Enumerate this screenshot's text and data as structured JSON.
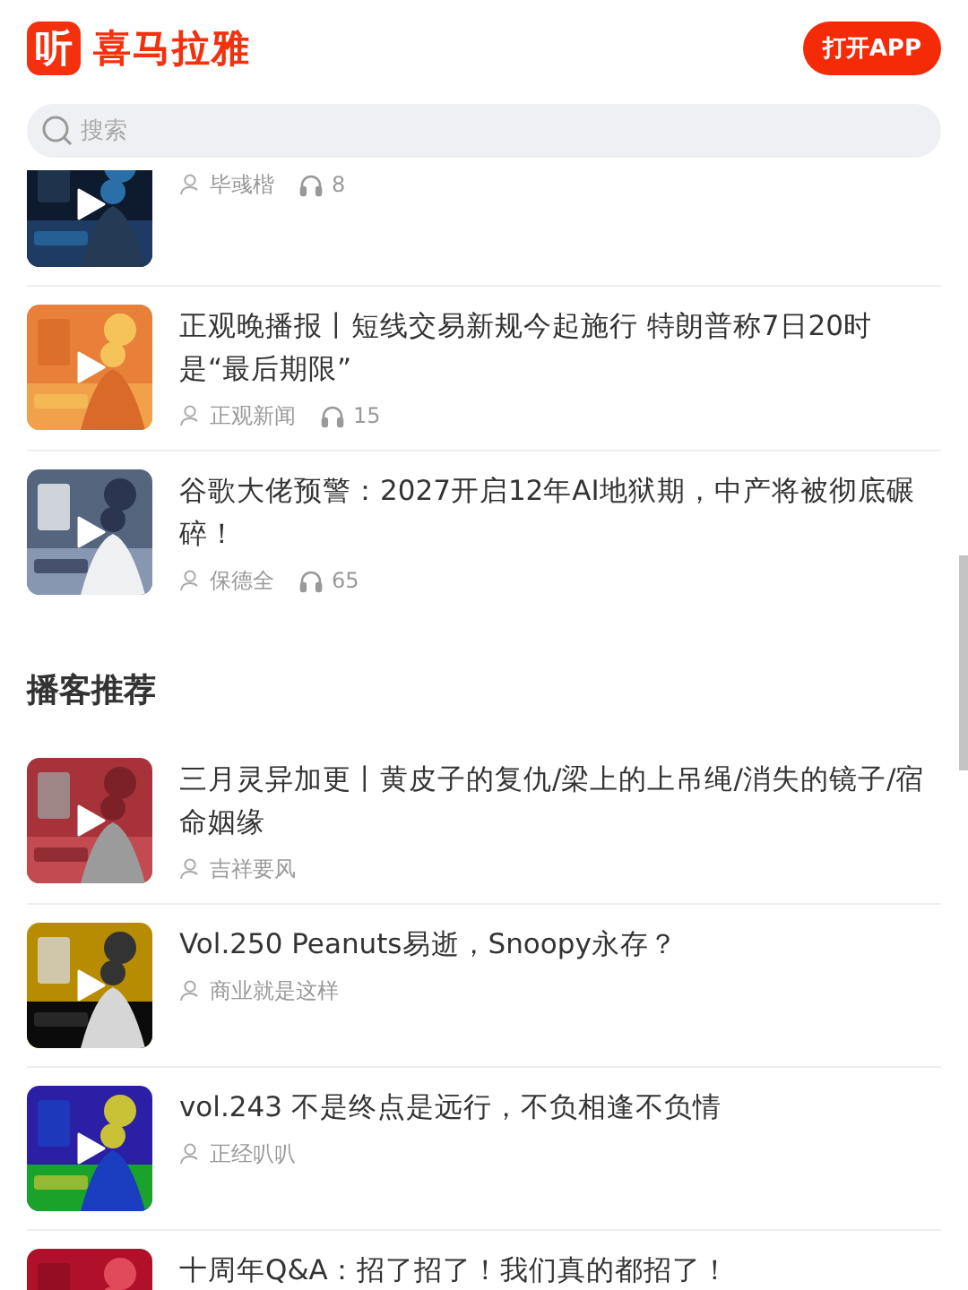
{
  "header": {
    "logo": {
      "mark": "听",
      "name": "喜马拉雅"
    },
    "open_app_button": "打开APP"
  },
  "search": {
    "placeholder": "搜索"
  },
  "tracks": [
    {
      "author": "毕彧楷",
      "plays": "8"
    },
    {
      "title": "正观晚播报丨短线交易新规今起施行 特朗普称7日20时是“最后期限”",
      "author": "正观新闻",
      "plays": "15"
    },
    {
      "title": "谷歌大佬预警：2027开启12年AI地狱期，中产将被彻底碾碎！",
      "author": "保德全",
      "plays": "65"
    }
  ],
  "podcast_section": {
    "title": "播客推荐",
    "items": [
      {
        "title": "三月灵异加更丨黄皮子的复仇/梁上的上吊绳/消失的镜子/宿命姻缘",
        "author": "吉祥要风"
      },
      {
        "title": "Vol.250 Peanuts易逝，Snoopy永存？",
        "author": "商业就是这样"
      },
      {
        "title": "vol.243 不是终点是远行，不负相逢不负情",
        "author": "正经叭叭"
      },
      {
        "title": "十周年Q&A：招了招了！我们真的都招了！"
      }
    ]
  }
}
